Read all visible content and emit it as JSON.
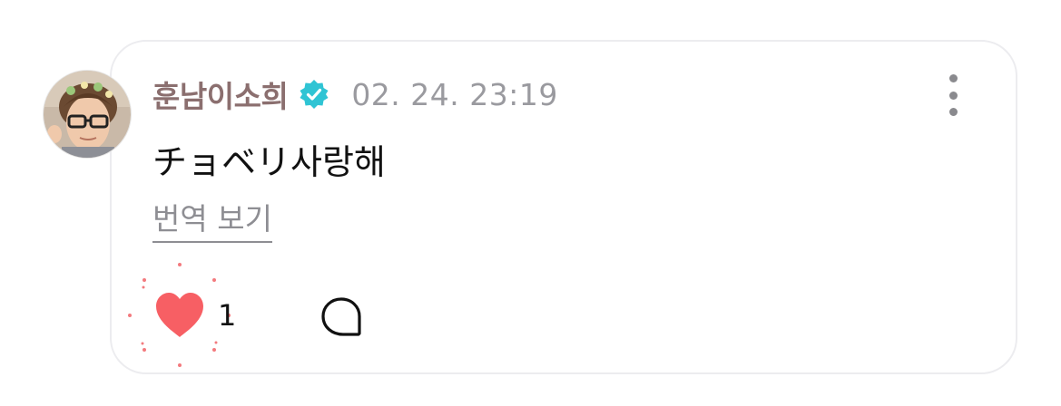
{
  "comment": {
    "username": "훈남이소희",
    "verified_icon": "verified-badge-icon",
    "timestamp": "02. 24. 23:19",
    "message": "チョベリ사랑해",
    "translate_label": "번역 보기",
    "like_count": "1",
    "liked": true
  },
  "colors": {
    "username": "#8b6f6f",
    "verified": "#2fc4d4",
    "heart": "#f75f64",
    "muted": "#9a9a9f",
    "border": "#ececef"
  },
  "icons": {
    "more": "more-vertical-icon",
    "like": "heart-icon",
    "comment": "comment-bubble-icon"
  }
}
